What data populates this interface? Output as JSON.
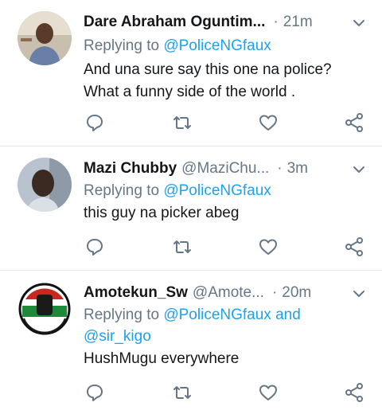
{
  "tweets": [
    {
      "name": "Dare Abraham Oguntim...",
      "handle": "",
      "time": "21m",
      "reply_prefix": "Replying to",
      "mention_1": "@PoliceNGfaux",
      "mention_join": "",
      "mention_2": "",
      "text_line_1": "And una sure say this one na police?",
      "text_line_2": "What a funny side of the world ."
    },
    {
      "name": "Mazi Chubby",
      "handle": "@MaziChu...",
      "time": "3m",
      "reply_prefix": "Replying to",
      "mention_1": "@PoliceNGfaux",
      "mention_join": "",
      "mention_2": "",
      "text_line_1": "this guy na picker abeg",
      "text_line_2": ""
    },
    {
      "name": "Amotekun_Sw",
      "handle": "@Amote...",
      "time": "20m",
      "reply_prefix": "Replying to",
      "mention_1": "@PoliceNGfaux",
      "mention_join": "and",
      "mention_2": "@sir_kigo",
      "text_line_1": "HushMugu everywhere",
      "text_line_2": ""
    }
  ],
  "icons": [
    "reply-icon",
    "retweet-icon",
    "like-icon",
    "share-icon",
    "chevron-down-icon"
  ],
  "colors": {
    "link": "#1da1f2",
    "muted": "#657786",
    "divider": "#e1e8ed"
  }
}
